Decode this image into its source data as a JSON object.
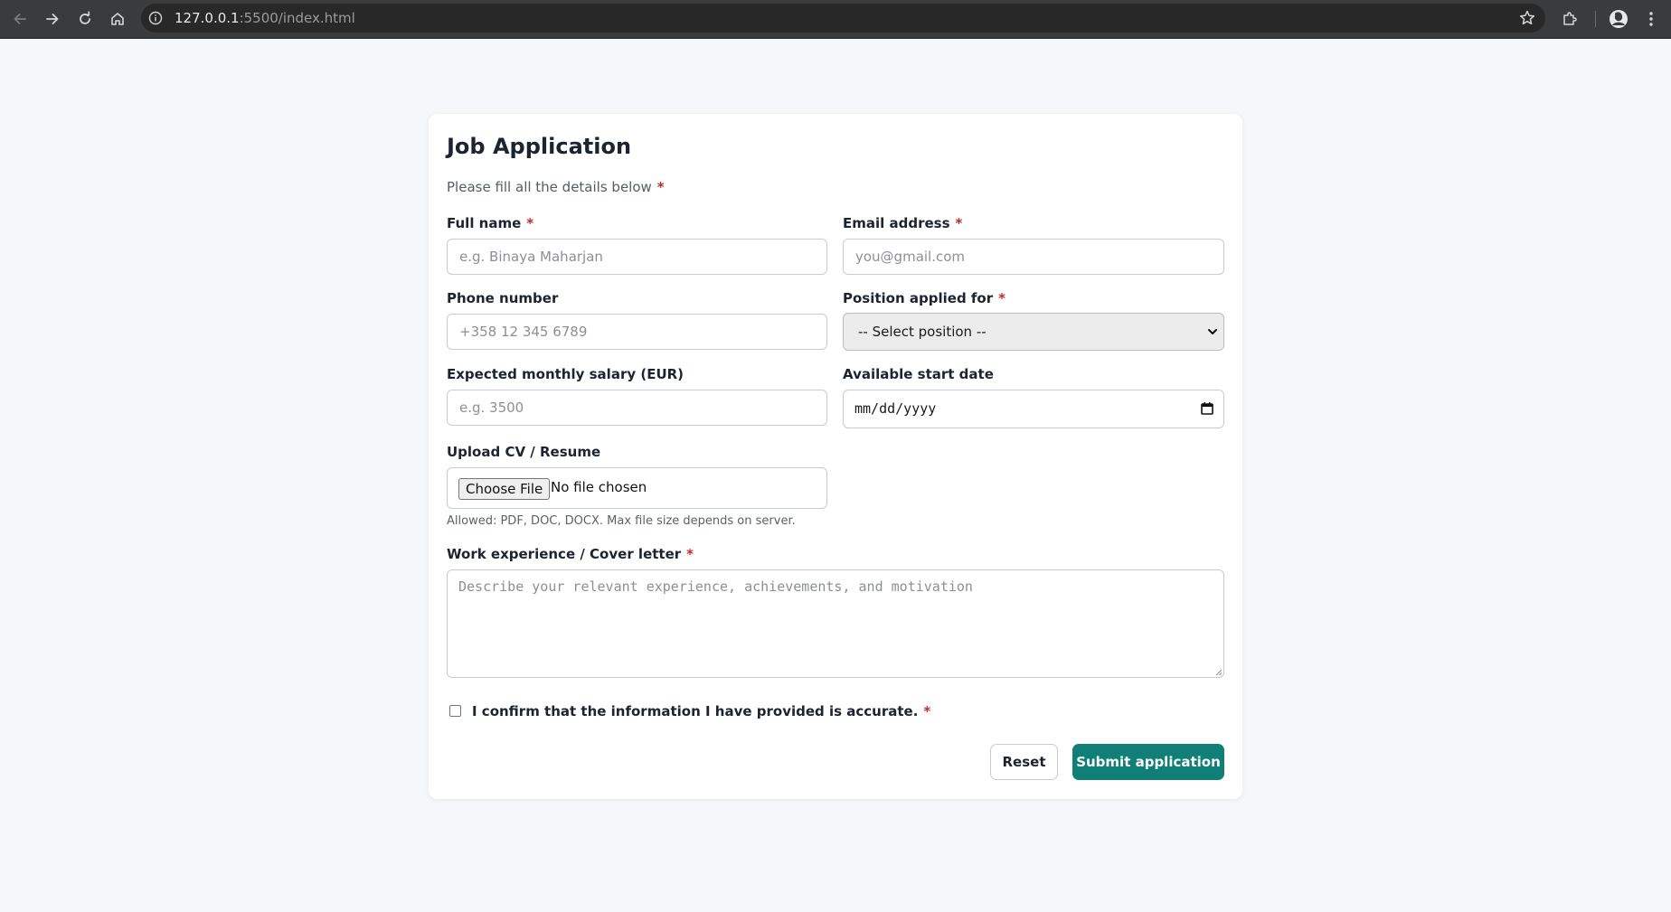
{
  "browser": {
    "url_host": "127.0.0.1",
    "url_path": ":5500/index.html"
  },
  "form": {
    "title": "Job Application",
    "subtitle": "Please fill all the details below",
    "required_mark": "*",
    "full_name": {
      "label": "Full name",
      "placeholder": "e.g. Binaya Maharjan",
      "value": "",
      "required": true
    },
    "email": {
      "label": "Email address",
      "placeholder": "you@gmail.com",
      "value": "",
      "required": true
    },
    "phone": {
      "label": "Phone number",
      "placeholder": "+358 12 345 6789",
      "value": "",
      "required": false
    },
    "position": {
      "label": "Position applied for",
      "selected": "-- Select position --",
      "required": true
    },
    "salary": {
      "label": "Expected monthly salary (EUR)",
      "placeholder": "e.g. 3500",
      "value": "",
      "required": false
    },
    "start_date": {
      "label": "Available start date",
      "value": "mm/dd/yyyy",
      "required": false
    },
    "cv": {
      "label": "Upload CV / Resume",
      "button_label": "Choose File",
      "status": "No file chosen",
      "hint": "Allowed: PDF, DOC, DOCX. Max file size depends on server."
    },
    "cover_letter": {
      "label": "Work experience / Cover letter",
      "placeholder": "Describe your relevant experience, achievements, and motivation",
      "value": "",
      "required": true
    },
    "confirm": {
      "label": "I confirm that the information I have provided is accurate.",
      "checked": false,
      "required": true
    },
    "buttons": {
      "reset": "Reset",
      "submit": "Submit application"
    }
  },
  "colors": {
    "accent": "#0f7f78",
    "required": "#c62828",
    "page_background": "#f5f8fa",
    "browser_toolbar": "#3a3b3d"
  },
  "icons": {
    "back": "arrow-left-icon",
    "forward": "arrow-right-icon",
    "reload": "reload-icon",
    "home": "home-icon",
    "site_info": "info-icon",
    "bookmark": "star-icon",
    "extensions": "puzzle-icon",
    "profile": "avatar-icon",
    "menu": "kebab-menu-icon",
    "select": "chevron-down-icon",
    "date": "calendar-icon"
  }
}
